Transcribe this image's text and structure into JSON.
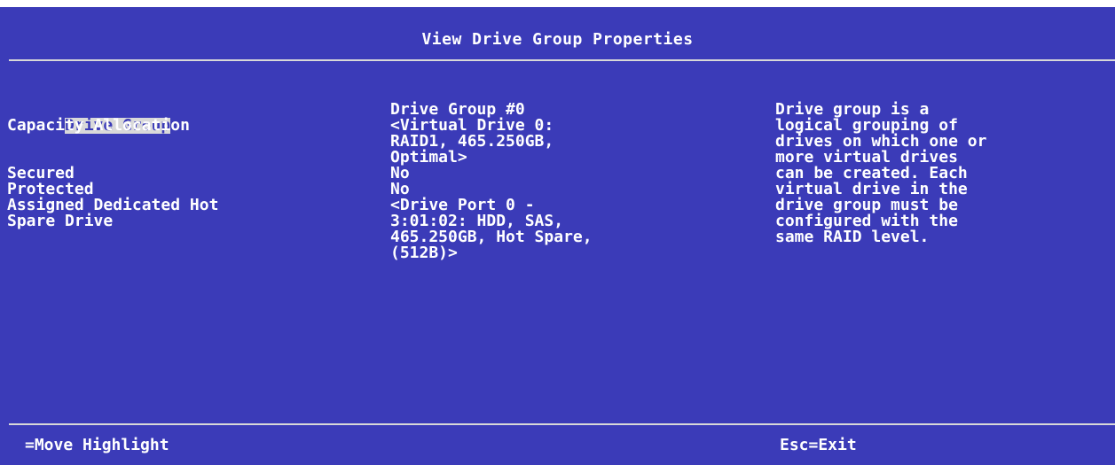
{
  "title": "View Drive Group Properties",
  "colors": {
    "background": "#3b3bb8",
    "text": "#ffffff",
    "highlight_bg": "#d9d9d9",
    "rule": "#d8d8d8"
  },
  "fields": {
    "drive_group_label": "Drive Group",
    "capacity_allocation_label": "Capacity Allocation",
    "secured_label": "Secured",
    "protected_label": "Protected",
    "assigned_hot_spare_label_1": "Assigned Dedicated Hot",
    "assigned_hot_spare_label_2": "Spare Drive"
  },
  "values": {
    "drive_group": "Drive Group #0",
    "capacity_allocation_1": "<Virtual Drive 0:",
    "capacity_allocation_2": "RAID1, 465.250GB,",
    "capacity_allocation_3": "Optimal>",
    "secured": "No",
    "protected": "No",
    "hot_spare_1": "<Drive Port 0 -",
    "hot_spare_2": "3:01:02: HDD, SAS,",
    "hot_spare_3": "465.250GB, Hot Spare,",
    "hot_spare_4": "(512B)>"
  },
  "help": {
    "lines": [
      "Drive group is a",
      "logical grouping of",
      "drives on which one or",
      "more virtual drives",
      "can be created. Each",
      "virtual drive in the",
      "drive group must be",
      "configured with the",
      "same RAID level."
    ]
  },
  "footer": {
    "left": "=Move Highlight",
    "right": "Esc=Exit"
  }
}
